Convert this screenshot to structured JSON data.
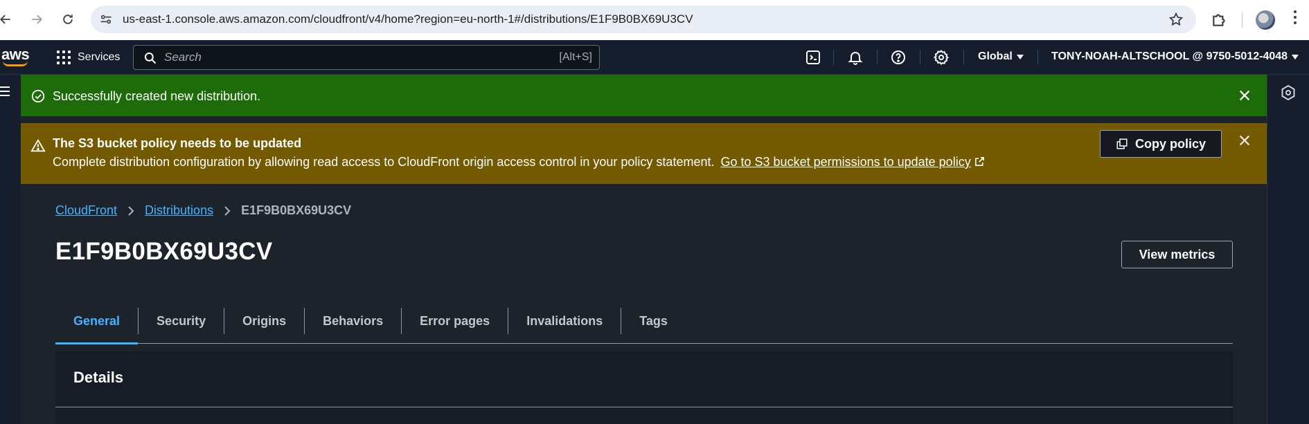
{
  "browser": {
    "url": "us-east-1.console.aws.amazon.com/cloudfront/v4/home?region=eu-north-1#/distributions/E1F9B0BX69U3CV"
  },
  "aws_nav": {
    "logo": "aws",
    "services_label": "Services",
    "search_placeholder": "Search",
    "search_shortcut": "[Alt+S]",
    "region_label": "Global",
    "account_label": "TONY-NOAH-ALTSCHOOL @ 9750-5012-4048"
  },
  "flash_success": {
    "message": "Successfully created new distribution."
  },
  "flash_warning": {
    "title": "The S3 bucket policy needs to be updated",
    "body": "Complete distribution configuration by allowing read access to CloudFront origin access control in your policy statement.",
    "link_text": "Go to S3 bucket permissions to update policy",
    "button_label": "Copy policy"
  },
  "breadcrumb": {
    "items": [
      "CloudFront",
      "Distributions"
    ],
    "current": "E1F9B0BX69U3CV"
  },
  "page": {
    "title": "E1F9B0BX69U3CV",
    "view_metrics_label": "View metrics"
  },
  "tabs": [
    {
      "label": "General",
      "active": true
    },
    {
      "label": "Security",
      "active": false
    },
    {
      "label": "Origins",
      "active": false
    },
    {
      "label": "Behaviors",
      "active": false
    },
    {
      "label": "Error pages",
      "active": false
    },
    {
      "label": "Invalidations",
      "active": false
    },
    {
      "label": "Tags",
      "active": false
    }
  ],
  "details": {
    "title": "Details"
  },
  "colors": {
    "success_bg": "#1e6b0a",
    "warning_bg": "#735a00",
    "link_blue": "#42b4ff",
    "nav_bg": "#161e2d",
    "content_bg": "#1d232b"
  }
}
